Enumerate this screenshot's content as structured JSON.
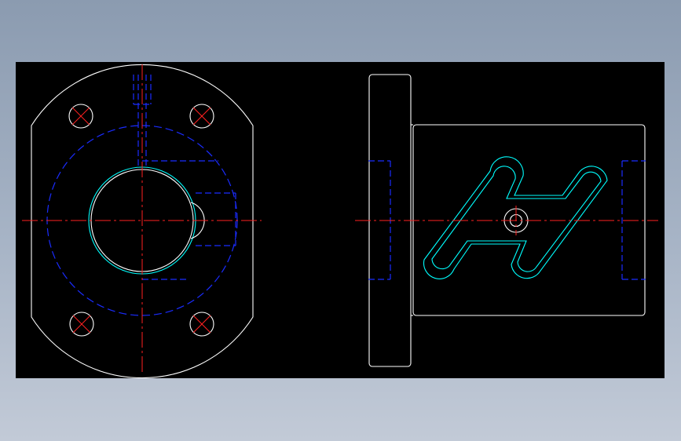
{
  "drawing": {
    "background": "#000000",
    "colors": {
      "outline": "#ffffff",
      "centerline": "#ff0000",
      "hidden": "#0000ff",
      "highlight": "#00ffff"
    },
    "views": [
      {
        "name": "front-view",
        "features": [
          "oval-flange",
          "mounting-holes",
          "bore",
          "hidden-pitch-circle",
          "vertical-slot"
        ]
      },
      {
        "name": "side-view",
        "features": [
          "flange-plate",
          "body",
          "spiral-groove",
          "center-hole"
        ]
      }
    ]
  }
}
